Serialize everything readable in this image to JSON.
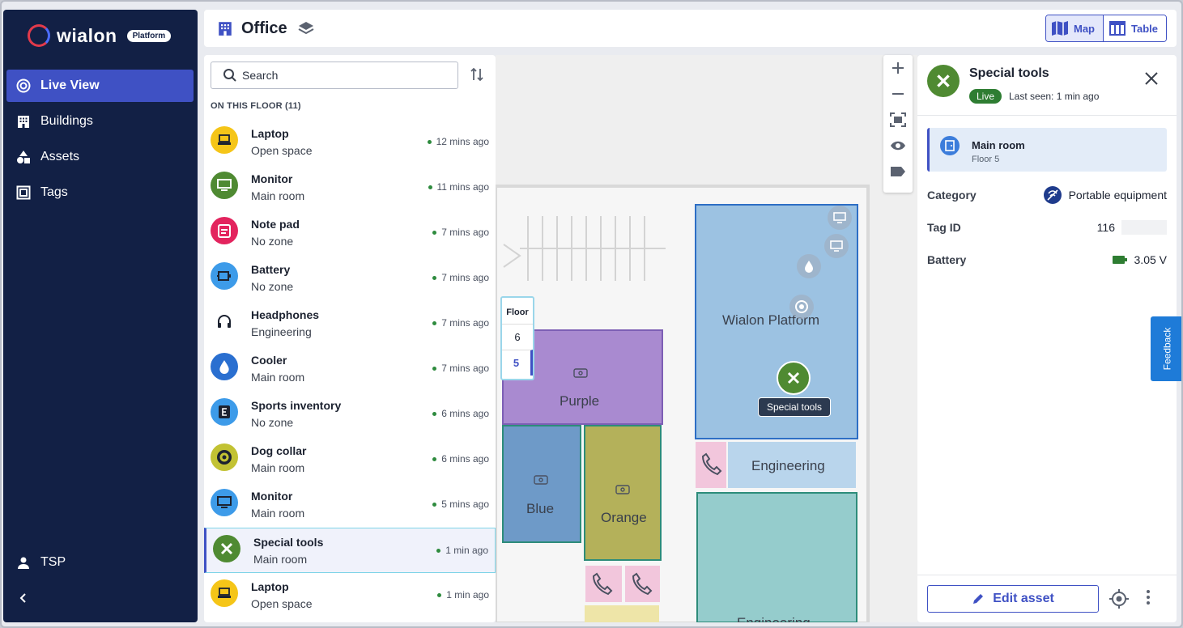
{
  "brand": {
    "name": "wialon",
    "badge": "Platform"
  },
  "nav": {
    "items": [
      {
        "label": "Live View",
        "icon": "live-view-icon",
        "active": true
      },
      {
        "label": "Buildings",
        "icon": "building-icon"
      },
      {
        "label": "Assets",
        "icon": "assets-icon"
      },
      {
        "label": "Tags",
        "icon": "tag-icon"
      }
    ],
    "user": "TSP"
  },
  "header": {
    "title": "Office",
    "map_label": "Map",
    "table_label": "Table"
  },
  "list": {
    "search_placeholder": "Search",
    "section": "ON THIS FLOOR (11)",
    "items": [
      {
        "name": "Laptop",
        "zone": "Open space",
        "time": "12 mins ago",
        "icon": "laptop-icon",
        "color": "#f5c518"
      },
      {
        "name": "Monitor",
        "zone": "Main room",
        "time": "11 mins ago",
        "icon": "monitor-icon",
        "color": "#4f8a32"
      },
      {
        "name": "Note pad",
        "zone": "No zone",
        "time": "7 mins ago",
        "icon": "notepad-icon",
        "color": "#e3245e"
      },
      {
        "name": "Battery",
        "zone": "No zone",
        "time": "7 mins ago",
        "icon": "battery-icon",
        "color": "#3d9be9"
      },
      {
        "name": "Headphones",
        "zone": "Engineering",
        "time": "7 mins ago",
        "icon": "headphones-icon",
        "color": "#ffffff"
      },
      {
        "name": "Cooler",
        "zone": "Main room",
        "time": "7 mins ago",
        "icon": "water-drop-icon",
        "color": "#2a6fd0"
      },
      {
        "name": "Sports inventory",
        "zone": "No zone",
        "time": "6 mins ago",
        "icon": "e-letter-icon",
        "color": "#3d9be9"
      },
      {
        "name": "Dog collar",
        "zone": "Main room",
        "time": "6 mins ago",
        "icon": "target-icon",
        "color": "#c2c233"
      },
      {
        "name": "Monitor",
        "zone": "Main room",
        "time": "5 mins ago",
        "icon": "monitor-icon",
        "color": "#3d9be9"
      },
      {
        "name": "Special tools",
        "zone": "Main room",
        "time": "1 min ago",
        "icon": "tools-icon",
        "color": "#4f8a32",
        "selected": true
      },
      {
        "name": "Laptop",
        "zone": "Open space",
        "time": "1 min ago",
        "icon": "laptop-icon",
        "color": "#f5c518"
      }
    ]
  },
  "map": {
    "floor_title": "Floor",
    "floors": [
      "6",
      "5"
    ],
    "active_floor": "5",
    "rooms": [
      "Purple",
      "Blue",
      "Orange",
      "Wialon Platform",
      "Engineering",
      "Engineering"
    ],
    "tooltip": "Special tools"
  },
  "details": {
    "title": "Special tools",
    "status": "Live",
    "last_seen": "Last seen: 1 min ago",
    "location": {
      "name": "Main room",
      "floor": "Floor 5"
    },
    "category_label": "Category",
    "category_value": "Portable equipment",
    "tag_label": "Tag ID",
    "tag_value": "116",
    "battery_label": "Battery",
    "battery_value": "3.05 V",
    "edit_label": "Edit asset"
  },
  "feedback": "Feedback",
  "colors": {
    "accent": "#3f51c4",
    "sidebar": "#122045",
    "live": "#2e7d32"
  }
}
